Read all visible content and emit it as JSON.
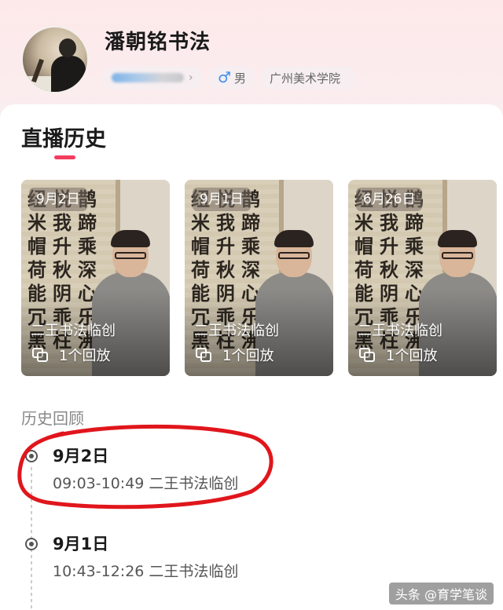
{
  "profile": {
    "name": "潘朝铭书法",
    "gender": "男",
    "school": "广州美术学院"
  },
  "live_history": {
    "title": "直播历史",
    "items": [
      {
        "date": "9月2日",
        "title": "二王书法临创",
        "replay": "1个回放"
      },
      {
        "date": "9月1日",
        "title": "二王书法临创",
        "replay": "1个回放"
      },
      {
        "date": "6月26日",
        "title": "二王书法临创",
        "replay": "1个回放"
      }
    ]
  },
  "review": {
    "label": "历史回顾",
    "entries": [
      {
        "date": "9月2日",
        "desc": "09:03-10:49 二王书法临创"
      },
      {
        "date": "9月1日",
        "desc": "10:43-12:26 二王书法临创"
      }
    ]
  },
  "watermark": "头条 @育学笔谈",
  "colors": {
    "accent": "#f23d5e",
    "gender_icon": "#3d8ef2",
    "annotation": "#e0161c"
  },
  "icons": {
    "gender": "male-icon",
    "replay": "replay-icon"
  }
}
